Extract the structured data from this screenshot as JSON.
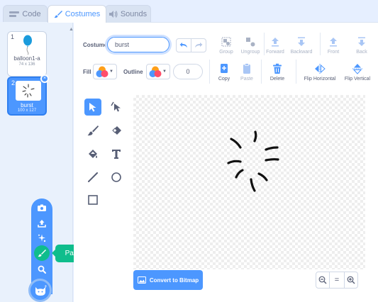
{
  "tabs": {
    "code": "Code",
    "costumes": "Costumes",
    "sounds": "Sounds"
  },
  "costumes": [
    {
      "number": "1",
      "name": "balloon1-a",
      "size": "74 x 136"
    },
    {
      "number": "2",
      "name": "burst",
      "size": "100 x 127"
    }
  ],
  "add_menu": {
    "tooltip": "Paint",
    "items": [
      "camera-icon",
      "upload-icon",
      "surprise-icon",
      "paint-icon",
      "search-icon"
    ]
  },
  "editor": {
    "costume_label": "Costume",
    "costume_name": "burst",
    "fill_label": "Fill",
    "outline_label": "Outline",
    "outline_size": "0",
    "toolbar": {
      "group": "Group",
      "ungroup": "Ungroup",
      "forward": "Forward",
      "backward": "Backward",
      "front": "Front",
      "back": "Back",
      "copy": "Copy",
      "paste": "Paste",
      "delete": "Delete",
      "flip_horizontal": "Flip Horizontal",
      "flip_vertical": "Flip Vertical"
    },
    "convert_label": "Convert to Bitmap",
    "zoom": {
      "out": "−",
      "reset": "=",
      "in": "+"
    }
  },
  "colors": {
    "accent": "#4c97ff",
    "paint_green": "#0fbd8c",
    "fill_swatch": [
      "#ff9f1a",
      "#4c97ff",
      "#ff4d6a"
    ]
  }
}
